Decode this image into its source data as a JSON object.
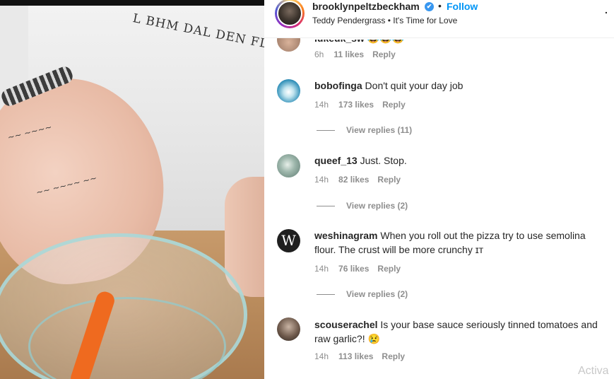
{
  "header": {
    "username": "brooklynpeltzbeckham",
    "verified_icon": "✔",
    "separator": "•",
    "follow_label": "Follow",
    "song": "Teddy Pendergrass • It's Time for Love",
    "more_icon": "."
  },
  "video": {
    "shirt_text": "L BHM DAL DEN FLL GRR IN"
  },
  "comments": [
    {
      "username": "lukeuk_sw",
      "text": "😂😂😂",
      "time": "6h",
      "likes": "11 likes",
      "reply": "Reply"
    },
    {
      "username": "bobofinga",
      "text": "Don't quit your day job",
      "time": "14h",
      "likes": "173 likes",
      "reply": "Reply",
      "view_replies": "View replies (11)"
    },
    {
      "username": "queef_13",
      "text": "Just. Stop.",
      "time": "14h",
      "likes": "82 likes",
      "reply": "Reply",
      "view_replies": "View replies (2)"
    },
    {
      "username": "weshinagram",
      "text": "When you roll out the pizza try to use semolina flour. The crust will be more crunchy ɪᴛ",
      "avatar_letter": "W",
      "time": "14h",
      "likes": "76 likes",
      "reply": "Reply",
      "view_replies": "View replies (2)"
    },
    {
      "username": "scouserachel",
      "text": "Is your base sauce seriously tinned tomatoes and raw garlic?! 😢",
      "time": "14h",
      "likes": "113 likes",
      "reply": "Reply"
    }
  ],
  "watermark": "Activa",
  "colors": {
    "link_blue": "#0095f6",
    "verified_blue": "#3897f0",
    "meta_gray": "#8e8e8e",
    "text": "#262626"
  }
}
